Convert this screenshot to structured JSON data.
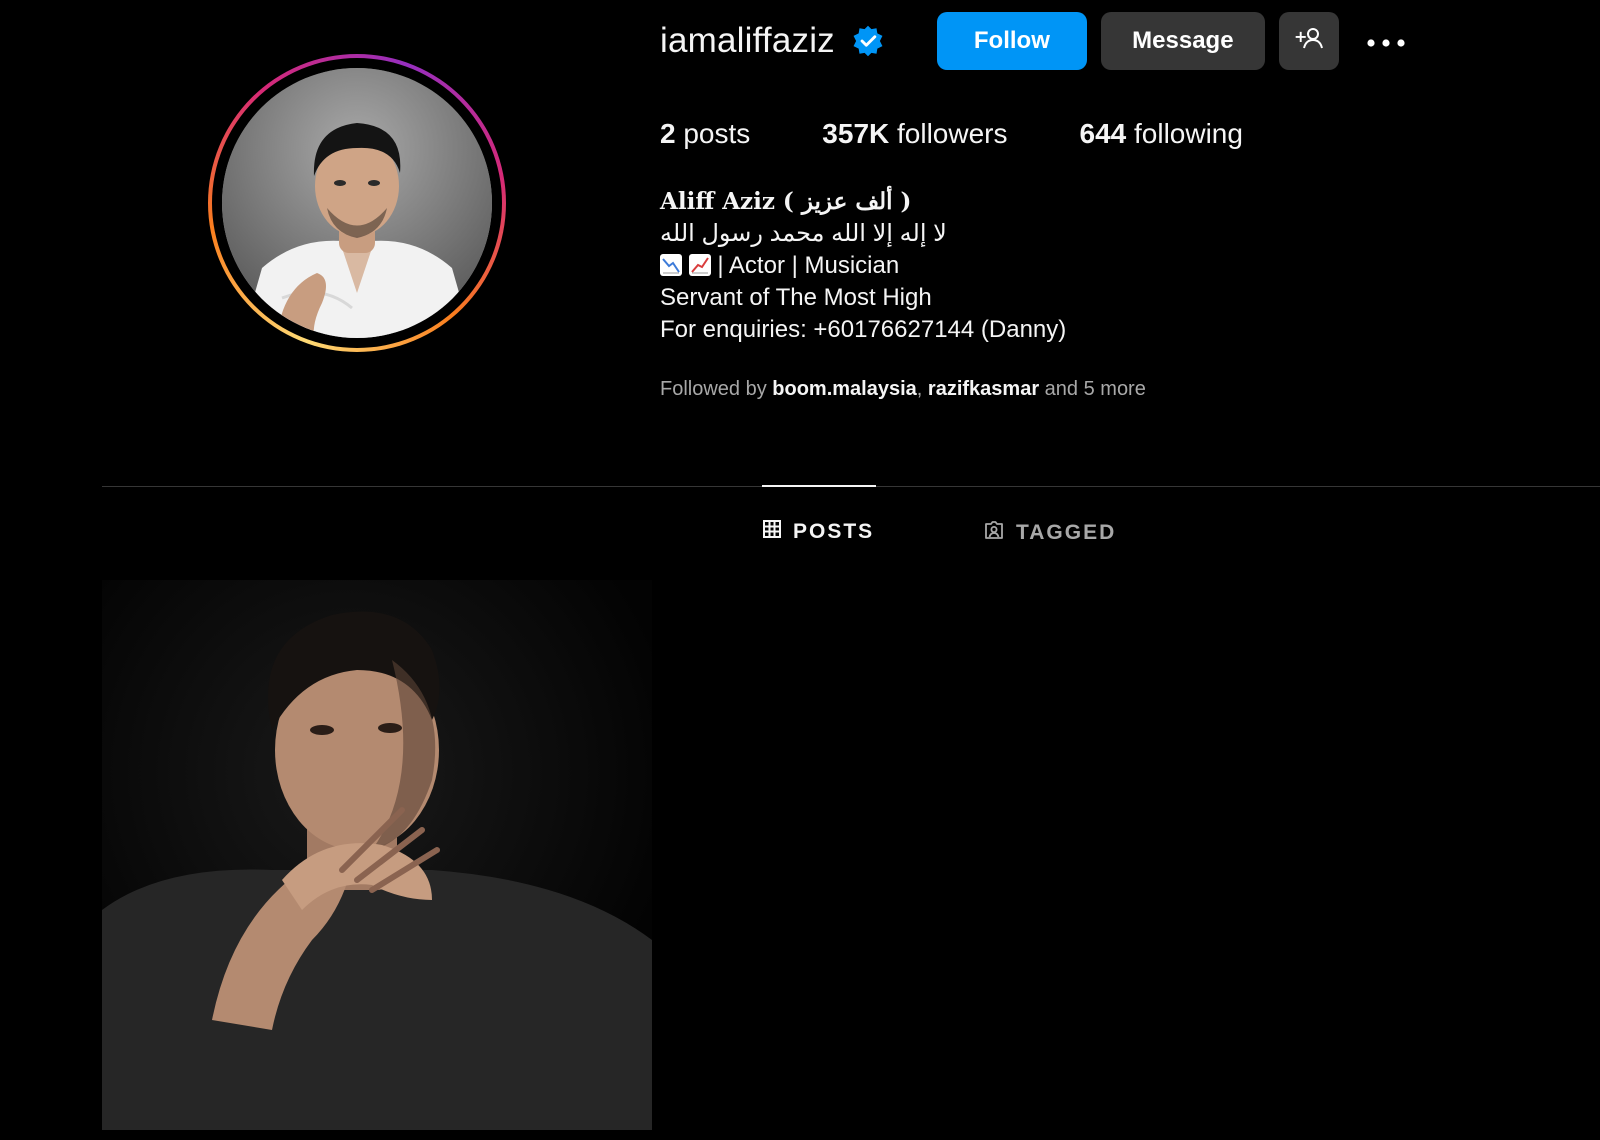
{
  "profile": {
    "username": "iamaliffaziz",
    "verified_icon": "verified-badge-icon",
    "accent_color": "#0095f6"
  },
  "actions": {
    "follow_label": "Follow",
    "message_label": "Message",
    "add_user_icon": "add-user-icon",
    "more_icon": "more-options-icon"
  },
  "stats": {
    "posts_count": "2",
    "posts_label": "posts",
    "followers_count": "357K",
    "followers_label": "followers",
    "following_count": "644",
    "following_label": "following"
  },
  "bio": {
    "name": "Aliff Aziz ( ألف عزيز )",
    "arabic_line": "لا إله إلا الله محمد رسول الله",
    "roles": "| Actor | Musician",
    "tagline": "Servant of The Most High",
    "enquiries": "For enquiries: +60176627144 (Danny)"
  },
  "followed_by": {
    "prefix": "Followed by",
    "accounts": [
      "boom.malaysia",
      "razifkasmar"
    ],
    "separator": ",",
    "suffix": "and 5 more"
  },
  "tabs": [
    {
      "label": "POSTS",
      "icon": "grid-icon",
      "active": true
    },
    {
      "label": "TAGGED",
      "icon": "tagged-icon",
      "active": false
    }
  ],
  "posts": [
    {
      "type": "photo"
    }
  ]
}
